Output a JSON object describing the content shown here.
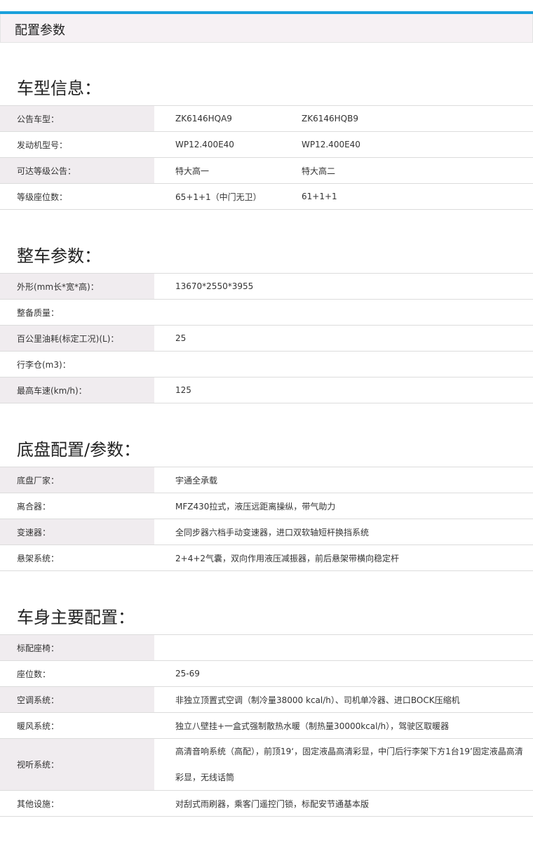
{
  "header": {
    "title": "配置参数"
  },
  "sections": [
    {
      "title": "车型信息：",
      "rows": [
        {
          "label": "公告车型：",
          "v1": "ZK6146HQA9",
          "v2": "ZK6146HQB9"
        },
        {
          "label": "发动机型号：",
          "v1": "WP12.400E40",
          "v2": "WP12.400E40"
        },
        {
          "label": "可达等级公告：",
          "v1": "特大高一",
          "v2": "特大高二"
        },
        {
          "label": "等级座位数：",
          "v1": "65+1+1（中门无卫）",
          "v2": "61+1+1"
        }
      ]
    },
    {
      "title": "整车参数：",
      "rows": [
        {
          "label": "外形(mm长*宽*高)：",
          "value": "13670*2550*3955"
        },
        {
          "label": "整备质量：",
          "value": ""
        },
        {
          "label": "百公里油耗(标定工况)(L)：",
          "value": "25"
        },
        {
          "label": "行李仓(m3)：",
          "value": ""
        },
        {
          "label": "最高车速(km/h)：",
          "value": "125"
        }
      ]
    },
    {
      "title": "底盘配置/参数：",
      "rows": [
        {
          "label": "底盘厂家：",
          "value": "宇通全承载"
        },
        {
          "label": "离合器：",
          "value": "MFZ430拉式，液压远距离操纵，带气助力"
        },
        {
          "label": "变速器：",
          "value": "全同步器六档手动变速器，进口双软轴短杆换挡系统"
        },
        {
          "label": "悬架系统：",
          "value": "2+4+2气囊，双向作用液压减振器，前后悬架带横向稳定杆"
        }
      ]
    },
    {
      "title": "车身主要配置：",
      "rows": [
        {
          "label": "标配座椅：",
          "value": ""
        },
        {
          "label": "座位数：",
          "value": "25-69"
        },
        {
          "label": "空调系统：",
          "value": "非独立顶置式空调（制冷量38000 kcal/h）、司机单冷器、进口BOCK压缩机"
        },
        {
          "label": "暖风系统：",
          "value": "独立八壁挂+一盒式强制散热水暖（制热量30000kcal/h），驾驶区取暖器"
        },
        {
          "label": "视听系统：",
          "value": "高清音响系统（高配），前顶19‘，固定液晶高清彩显，中门后行李架下方1台19’固定液晶高清彩显，无线话筒"
        },
        {
          "label": "其他设施：",
          "value": "对刮式雨刷器，乘客门遥控门锁，标配安节通基本版"
        }
      ]
    }
  ]
}
